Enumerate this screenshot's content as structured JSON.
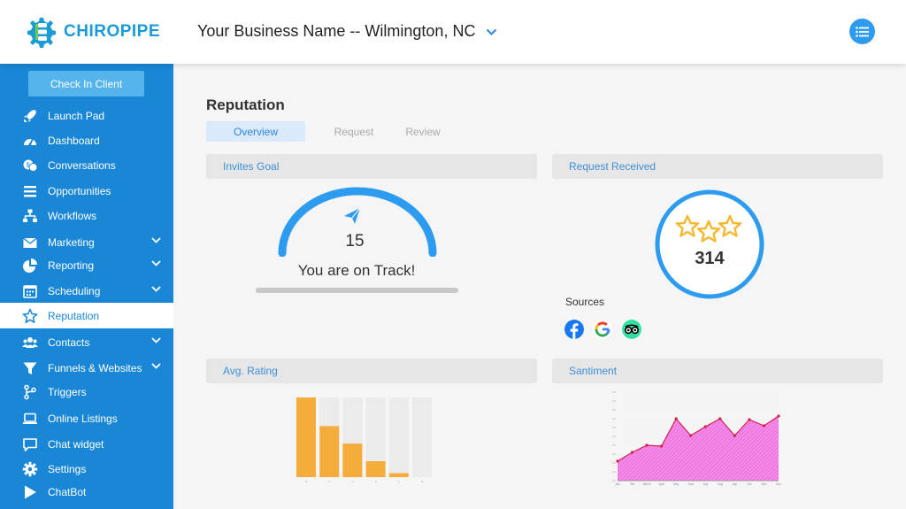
{
  "app": {
    "name": "CHIROPIPE",
    "brand_color": "#1a9bd7"
  },
  "header": {
    "business_name": "Your Business Name -- Wilmington, NC"
  },
  "sidebar": {
    "check_in_label": "Check In Client",
    "items": [
      {
        "label": "Launch Pad",
        "icon": "rocket-icon"
      },
      {
        "label": "Dashboard",
        "icon": "speedometer-icon"
      },
      {
        "label": "Conversations",
        "icon": "chat-bubbles-icon"
      },
      {
        "label": "Opportunities",
        "icon": "list-lines-icon"
      },
      {
        "label": "Workflows",
        "icon": "sitemap-icon"
      },
      {
        "label": "Marketing",
        "icon": "envelope-icon",
        "expandable": true
      },
      {
        "label": "Reporting",
        "icon": "pie-chart-icon",
        "expandable": true
      },
      {
        "label": "Scheduling",
        "icon": "calendar-icon",
        "expandable": true
      },
      {
        "label": "Reputation",
        "icon": "star-icon",
        "active": true
      },
      {
        "label": "Contacts",
        "icon": "users-icon",
        "expandable": true
      },
      {
        "label": "Funnels & Websites",
        "icon": "funnel-icon",
        "expandable": true
      },
      {
        "label": "Triggers",
        "icon": "branch-icon"
      },
      {
        "label": "Online Listings",
        "icon": "laptop-icon"
      },
      {
        "label": "Chat widget",
        "icon": "chat-box-icon"
      },
      {
        "label": "Settings",
        "icon": "gear-icon"
      },
      {
        "label": "ChatBot",
        "icon": "play-icon"
      }
    ]
  },
  "main": {
    "title": "Reputation",
    "tabs": [
      {
        "label": "Overview",
        "active": true
      },
      {
        "label": "Request",
        "active": false
      },
      {
        "label": "Review",
        "active": false
      }
    ],
    "invites_goal": {
      "header": "Invites Goal",
      "count": "15",
      "status": "You are on Track!"
    },
    "request_received": {
      "header": "Request Received",
      "count": "314",
      "sources_label": "Sources",
      "sources": [
        "facebook-icon",
        "google-icon",
        "tripadvisor-icon"
      ]
    },
    "avg_rating": {
      "header": "Avg. Rating"
    },
    "sentiment": {
      "header": "Santiment"
    }
  },
  "colors": {
    "sidebar": "#1a87d6",
    "accent": "#2d9cf0",
    "bar": "#f5ac3b",
    "area_line": "#d0204a",
    "area_fill": "#f58ce9"
  },
  "chart_data": [
    {
      "type": "bar",
      "categories": [
        "5",
        "4",
        "3",
        "2",
        "1",
        "0"
      ],
      "values": [
        100,
        64,
        42,
        20,
        5,
        0
      ],
      "ylim": [
        0,
        100
      ]
    },
    {
      "type": "area",
      "x": [
        "Jan",
        "Feb",
        "March",
        "April",
        "May",
        "June",
        "July",
        "Aug",
        "Sep",
        "Oct",
        "Nov",
        "Dec"
      ],
      "values": [
        22,
        32,
        40,
        39,
        70,
        51,
        61,
        70,
        51,
        69,
        62,
        73
      ],
      "ylim": [
        0,
        100
      ]
    }
  ]
}
